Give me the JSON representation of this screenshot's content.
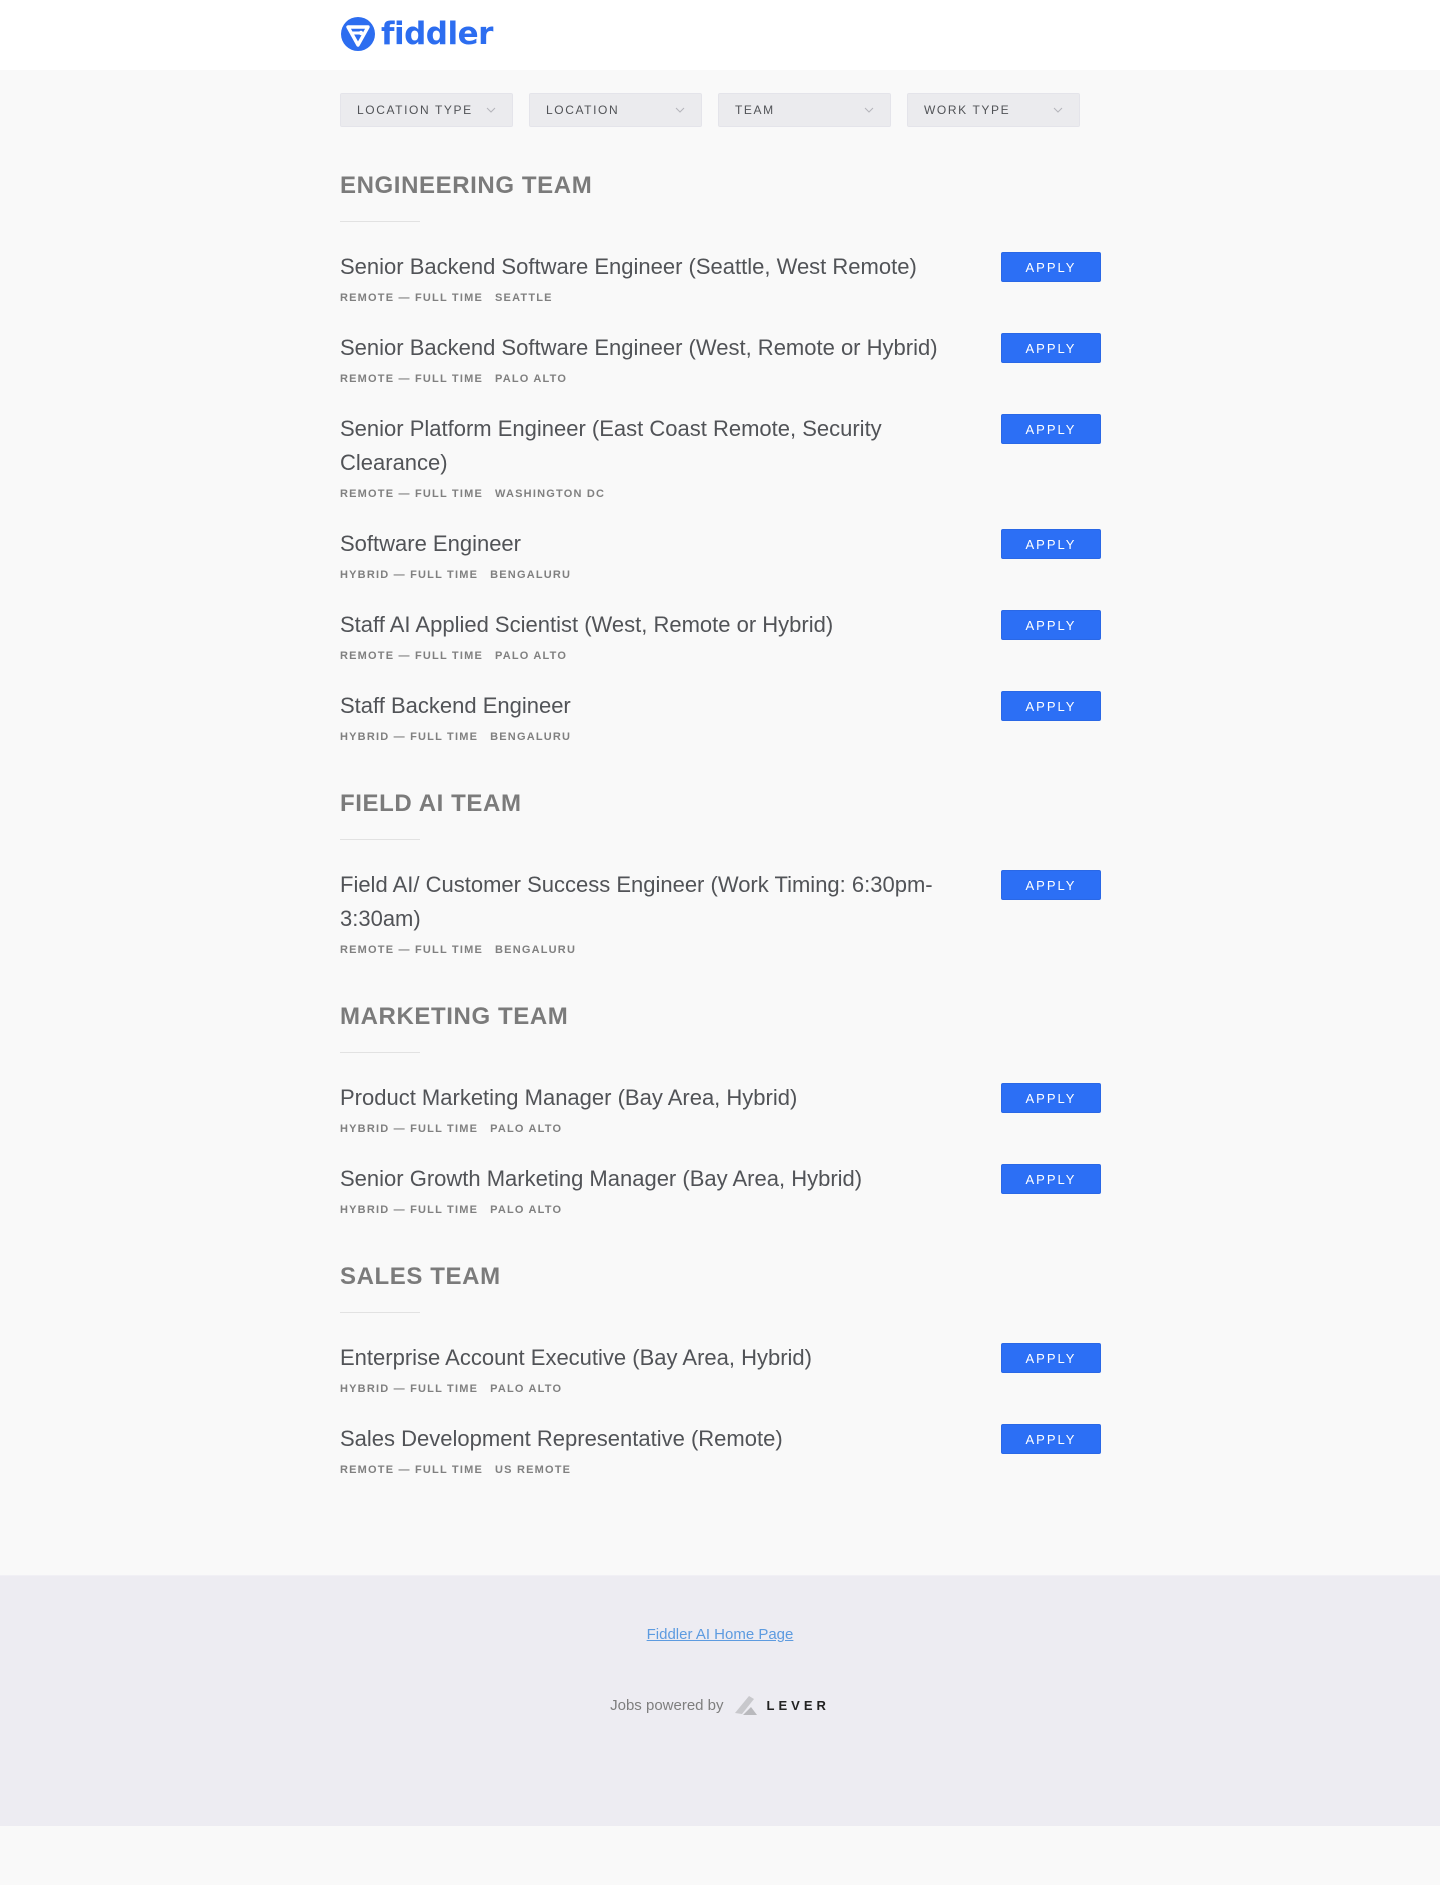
{
  "header": {
    "logo_icon": "fiddler-logo-icon",
    "logo_text": "fiddler",
    "brand_color": "#2c6df0"
  },
  "filters": [
    {
      "label": "LOCATION TYPE",
      "icon": "chevron-down-icon"
    },
    {
      "label": "LOCATION",
      "icon": "chevron-down-icon"
    },
    {
      "label": "TEAM",
      "icon": "chevron-down-icon"
    },
    {
      "label": "WORK TYPE",
      "icon": "chevron-down-icon"
    }
  ],
  "teams": [
    {
      "name": "ENGINEERING TEAM",
      "jobs": [
        {
          "title": "Senior Backend Software Engineer (Seattle, West Remote)",
          "commitment": "REMOTE — FULL TIME",
          "location": "SEATTLE",
          "apply": "APPLY"
        },
        {
          "title": "Senior Backend Software Engineer (West, Remote or Hybrid)",
          "commitment": "REMOTE — FULL TIME",
          "location": "PALO ALTO",
          "apply": "APPLY"
        },
        {
          "title": "Senior Platform Engineer (East Coast Remote, Security Clearance)",
          "commitment": "REMOTE — FULL TIME",
          "location": "WASHINGTON DC",
          "apply": "APPLY"
        },
        {
          "title": "Software Engineer",
          "commitment": "HYBRID — FULL TIME",
          "location": "BENGALURU",
          "apply": "APPLY"
        },
        {
          "title": "Staff AI Applied Scientist (West, Remote or Hybrid)",
          "commitment": "REMOTE — FULL TIME",
          "location": "PALO ALTO",
          "apply": "APPLY"
        },
        {
          "title": "Staff Backend Engineer",
          "commitment": "HYBRID — FULL TIME",
          "location": "BENGALURU",
          "apply": "APPLY"
        }
      ]
    },
    {
      "name": "FIELD AI TEAM",
      "jobs": [
        {
          "title": "Field AI/ Customer Success Engineer (Work Timing: 6:30pm-3:30am)",
          "commitment": "REMOTE — FULL TIME",
          "location": "BENGALURU",
          "apply": "APPLY"
        }
      ]
    },
    {
      "name": "MARKETING TEAM",
      "jobs": [
        {
          "title": "Product Marketing Manager (Bay Area, Hybrid)",
          "commitment": "HYBRID — FULL TIME",
          "location": "PALO ALTO",
          "apply": "APPLY"
        },
        {
          "title": "Senior Growth Marketing Manager (Bay Area, Hybrid)",
          "commitment": "HYBRID — FULL TIME",
          "location": "PALO ALTO",
          "apply": "APPLY"
        }
      ]
    },
    {
      "name": "SALES TEAM",
      "jobs": [
        {
          "title": "Enterprise Account Executive (Bay Area, Hybrid)",
          "commitment": "HYBRID — FULL TIME",
          "location": "PALO ALTO",
          "apply": "APPLY"
        },
        {
          "title": "Sales Development Representative (Remote)",
          "commitment": "REMOTE — FULL TIME",
          "location": "US REMOTE",
          "apply": "APPLY"
        }
      ]
    }
  ],
  "footer": {
    "home_link": "Fiddler AI Home Page",
    "powered_by": "Jobs powered by",
    "lever_icon": "lever-logo-icon",
    "lever_text": "LEVER"
  },
  "colors": {
    "apply_button": "#2c6ff5",
    "page_background": "#f9f9f9",
    "footer_background": "#edecf2",
    "link": "#5d9be0"
  }
}
